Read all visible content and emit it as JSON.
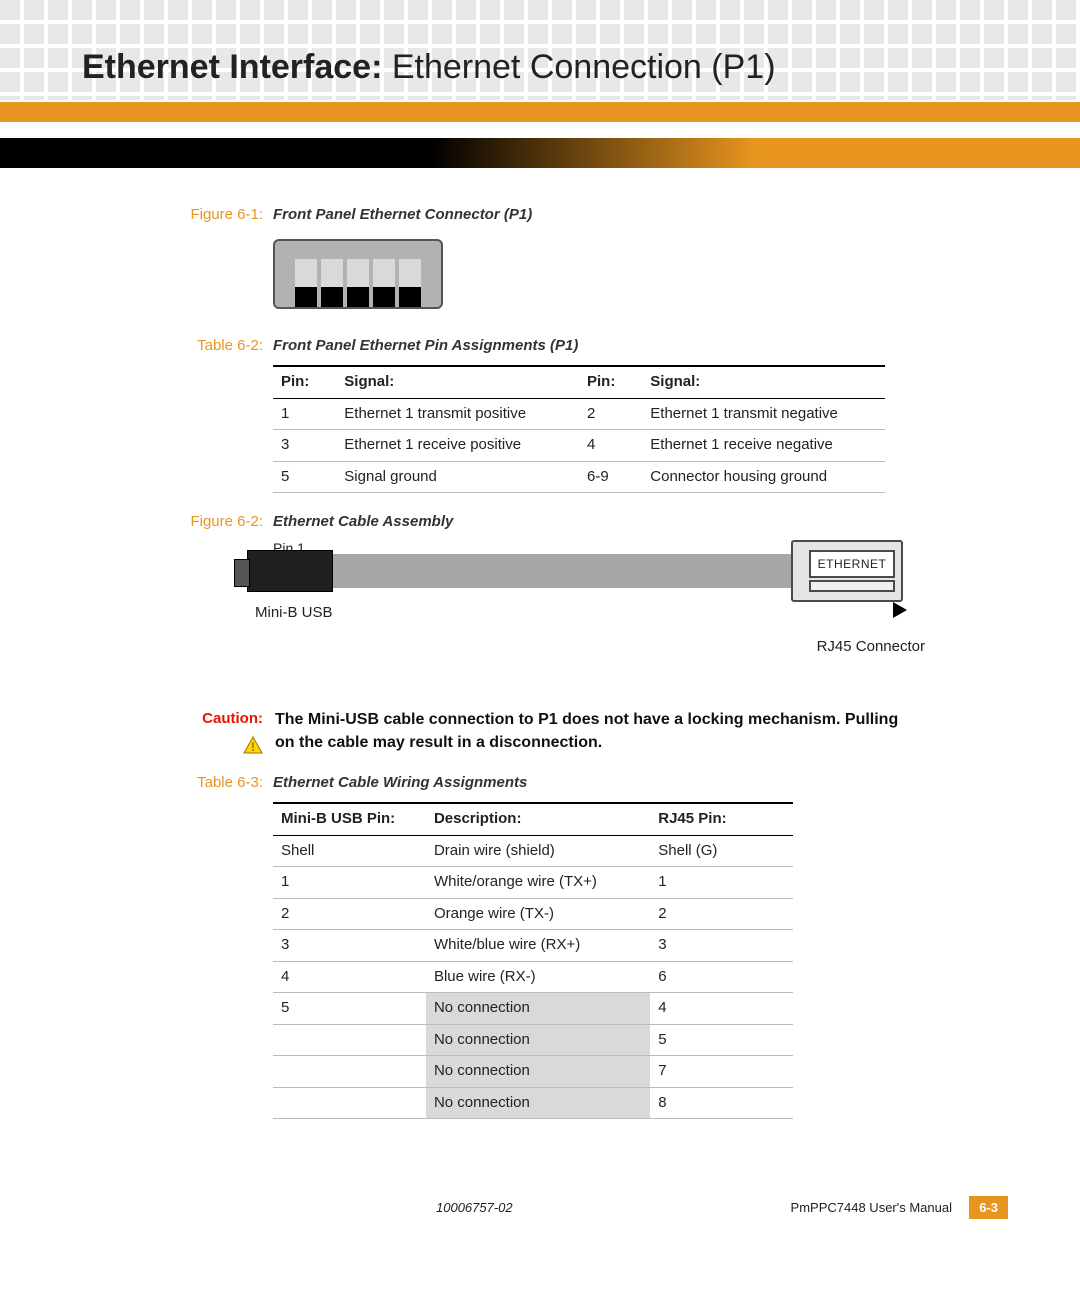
{
  "header": {
    "title_bold": "Ethernet Interface:",
    "title_rest": "  Ethernet Connection (P1)"
  },
  "fig61": {
    "label": "Figure 6-1:",
    "caption": "Front Panel Ethernet Connector (P1)",
    "pin1": "Pin 1"
  },
  "tbl62": {
    "label": "Table 6-2:",
    "caption": "Front Panel Ethernet Pin Assignments (P1)",
    "headers": {
      "pin": "Pin:",
      "signal": "Signal:"
    },
    "rows": [
      {
        "p1": "1",
        "s1": "Ethernet 1 transmit positive",
        "p2": "2",
        "s2": "Ethernet 1 transmit negative"
      },
      {
        "p1": "3",
        "s1": "Ethernet 1 receive positive",
        "p2": "4",
        "s2": "Ethernet 1 receive negative"
      },
      {
        "p1": "5",
        "s1": "Signal ground",
        "p2": "6-9",
        "s2": "Connector housing ground"
      }
    ]
  },
  "fig62": {
    "label": "Figure 6-2:",
    "caption": "Ethernet Cable Assembly",
    "minib": "Mini-B USB",
    "ethernet": "ETHERNET",
    "rj45": "RJ45 Connector"
  },
  "caution": {
    "label": "Caution:",
    "text": "The Mini-USB cable connection to P1 does not have a locking mechanism. Pulling on the cable may result in a disconnection."
  },
  "tbl63": {
    "label": "Table 6-3:",
    "caption": "Ethernet Cable Wiring Assignments",
    "headers": {
      "c1": "Mini-B USB Pin:",
      "c2": "Description:",
      "c3": "RJ45 Pin:"
    },
    "rows": [
      {
        "a": "Shell",
        "b": "Drain wire (shield)",
        "c": "Shell (G)",
        "nc": false
      },
      {
        "a": "1",
        "b": "White/orange wire (TX+)",
        "c": "1",
        "nc": false
      },
      {
        "a": "2",
        "b": "Orange wire (TX-)",
        "c": "2",
        "nc": false
      },
      {
        "a": "3",
        "b": "White/blue wire (RX+)",
        "c": "3",
        "nc": false
      },
      {
        "a": "4",
        "b": "Blue wire (RX-)",
        "c": "6",
        "nc": false
      },
      {
        "a": "5",
        "b": "No connection",
        "c": "4",
        "nc": true
      },
      {
        "a": "",
        "b": "No connection",
        "c": "5",
        "nc": true
      },
      {
        "a": "",
        "b": "No connection",
        "c": "7",
        "nc": true
      },
      {
        "a": "",
        "b": "No connection",
        "c": "8",
        "nc": true
      }
    ]
  },
  "footer": {
    "docnum": "10006757-02",
    "manual": "PmPPC7448  User's Manual",
    "page": "6-3"
  }
}
